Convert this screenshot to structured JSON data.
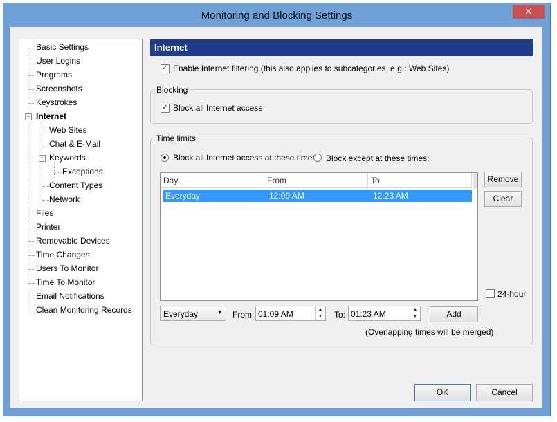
{
  "window": {
    "title": "Monitoring and Blocking Settings",
    "close_glyph": "✕"
  },
  "tree": {
    "items": [
      "Basic Settings",
      "User Logins",
      "Programs",
      "Screenshots",
      "Keystrokes",
      "Internet",
      "Web Sites",
      "Chat & E-Mail",
      "Keywords",
      "Exceptions",
      "Content Types",
      "Network",
      "Files",
      "Printer",
      "Removable Devices",
      "Time Changes",
      "Users To Monitor",
      "Time To Monitor",
      "Email Notifications",
      "Clean Monitoring Records"
    ],
    "selected": "Internet"
  },
  "panel": {
    "header": "Internet",
    "enable_filtering": {
      "label": "Enable Internet filtering (this also applies to subcategories, e.g.: Web Sites)",
      "checked": true
    },
    "blocking": {
      "title": "Blocking",
      "block_all": {
        "label": "Block all Internet access",
        "checked": true
      }
    },
    "time_limits": {
      "title": "Time limits",
      "radio_block_at": {
        "label": "Block all Internet access at these times:",
        "selected": true
      },
      "radio_block_except": {
        "label": "Block except at these times:",
        "selected": false
      },
      "columns": [
        "Day",
        "From",
        "To"
      ],
      "rows": [
        {
          "day": "Everyday",
          "from": "12:09 AM",
          "to": "12:23 AM"
        }
      ],
      "remove_label": "Remove",
      "clear_label": "Clear",
      "hour24": {
        "label": "24-hour",
        "checked": false
      },
      "day_select": "Everyday",
      "from_label": "From:",
      "from_value": "01:09 AM",
      "to_label": "To:",
      "to_value": "01:23 AM",
      "add_label": "Add",
      "note": "(Overlapping times will be merged)"
    }
  },
  "footer": {
    "ok_label": "OK",
    "cancel_label": "Cancel"
  },
  "colors": {
    "header_bg": "#1e3b8c",
    "selection": "#3399ff",
    "window_frame": "#6fa0d8",
    "close_button": "#c75050"
  }
}
